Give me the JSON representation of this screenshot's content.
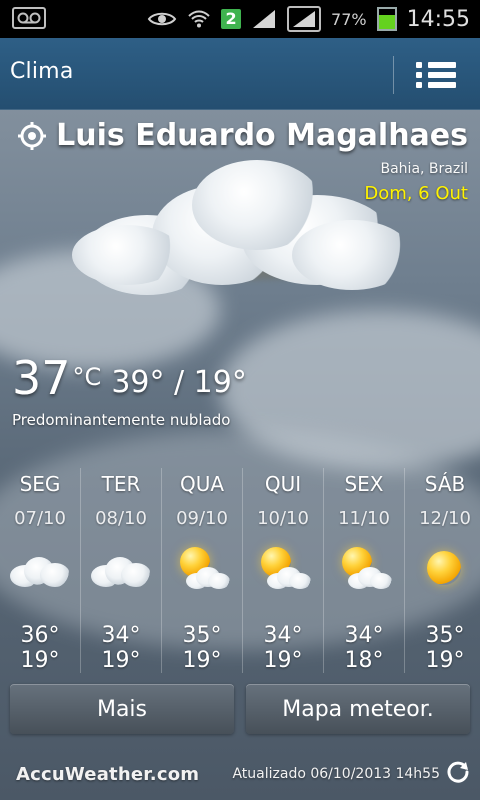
{
  "status_bar": {
    "battery_percent": "77%",
    "sim_badge": "2",
    "time": "14:55",
    "icons": [
      "voicemail-icon",
      "eye-icon",
      "wifi-icon",
      "signal-icon",
      "signal-icon",
      "battery-icon"
    ],
    "battery_level": 0.77,
    "colors": {
      "battery_fill": "#64d21e",
      "badge": "#3fb34f"
    }
  },
  "app_bar": {
    "title": "Clima",
    "menu_icon": "list-menu-icon",
    "colors": {
      "top": "#2e5f86",
      "bottom": "#244e70"
    }
  },
  "location": {
    "city": "Luis Eduardo Magalhaes",
    "region": "Bahia, Brazil",
    "date": "Dom, 6 Out",
    "location_icon": "locate-target-icon",
    "colors": {
      "date": "#fff300"
    }
  },
  "current": {
    "temp": "37",
    "unit": "°C",
    "hi_lo": "39° / 19°",
    "condition": "Predominantemente nublado"
  },
  "forecast": {
    "days": [
      {
        "name": "SEG",
        "date": "07/10",
        "icon": "cloudy-icon",
        "high": "36°",
        "low": "19°"
      },
      {
        "name": "TER",
        "date": "08/10",
        "icon": "cloudy-icon",
        "high": "34°",
        "low": "19°"
      },
      {
        "name": "QUA",
        "date": "09/10",
        "icon": "partly-sunny-icon",
        "high": "35°",
        "low": "19°"
      },
      {
        "name": "QUI",
        "date": "10/10",
        "icon": "partly-sunny-icon",
        "high": "34°",
        "low": "19°"
      },
      {
        "name": "SEX",
        "date": "11/10",
        "icon": "partly-sunny-icon",
        "high": "34°",
        "low": "18°"
      },
      {
        "name": "SÁB",
        "date": "12/10",
        "icon": "sunny-icon",
        "high": "35°",
        "low": "19°"
      }
    ]
  },
  "actions": {
    "more_label": "Mais",
    "map_label": "Mapa meteor."
  },
  "footer": {
    "brand": "AccuWeather.com",
    "updated": "Atualizado 06/10/2013 14h55",
    "refresh_icon": "refresh-icon"
  }
}
